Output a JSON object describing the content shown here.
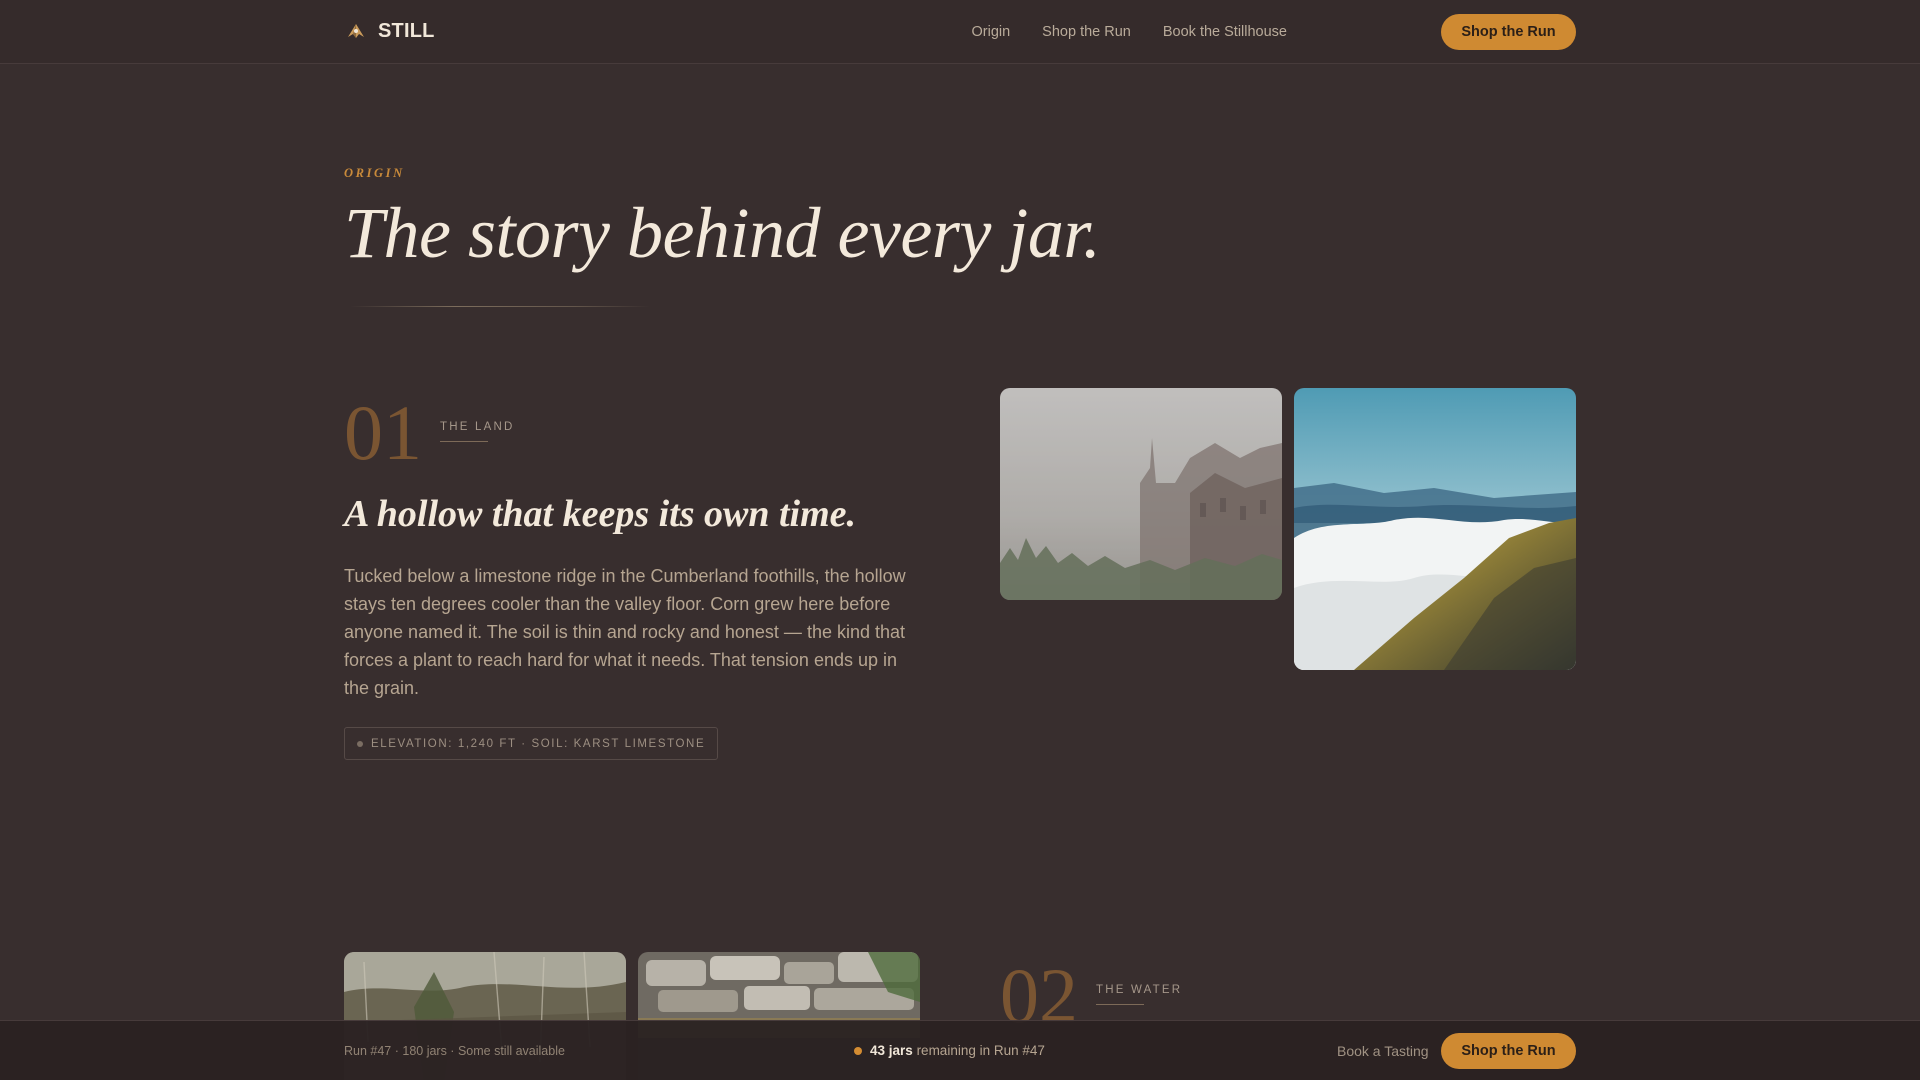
{
  "brand": {
    "name": "STILL"
  },
  "nav": {
    "links": [
      "Origin",
      "Shop the Run",
      "Book the Stillhouse"
    ],
    "cta": "Shop the Run"
  },
  "hero": {
    "eyebrow": "ORIGIN",
    "title": "The story behind every jar."
  },
  "sections": [
    {
      "number": "01",
      "label": "THE LAND",
      "heading": "A hollow that keeps its own time.",
      "body": "Tucked below a limestone ridge in the Cumberland foothills, the hollow stays ten degrees cooler than the valley floor. Corn grew here before anyone named it. The soil is thin and rocky and honest — the kind that forces a plant to reach hard for what it needs. That tension ends up in the grain.",
      "tag": "ELEVATION: 1,240 FT · SOIL: KARST LIMESTONE"
    },
    {
      "number": "02",
      "label": "THE WATER"
    }
  ],
  "bottom_bar": {
    "run_info": "Run #47 · 180 jars · Some still available",
    "remaining_count": "43 jars",
    "remaining_text": "remaining in Run #47",
    "book_link": "Book a Tasting",
    "cta": "Shop the Run"
  },
  "colors": {
    "background": "#382e2e",
    "accent": "#cf8a32",
    "section_number": "#7a5532",
    "heading": "#f3e9db"
  }
}
